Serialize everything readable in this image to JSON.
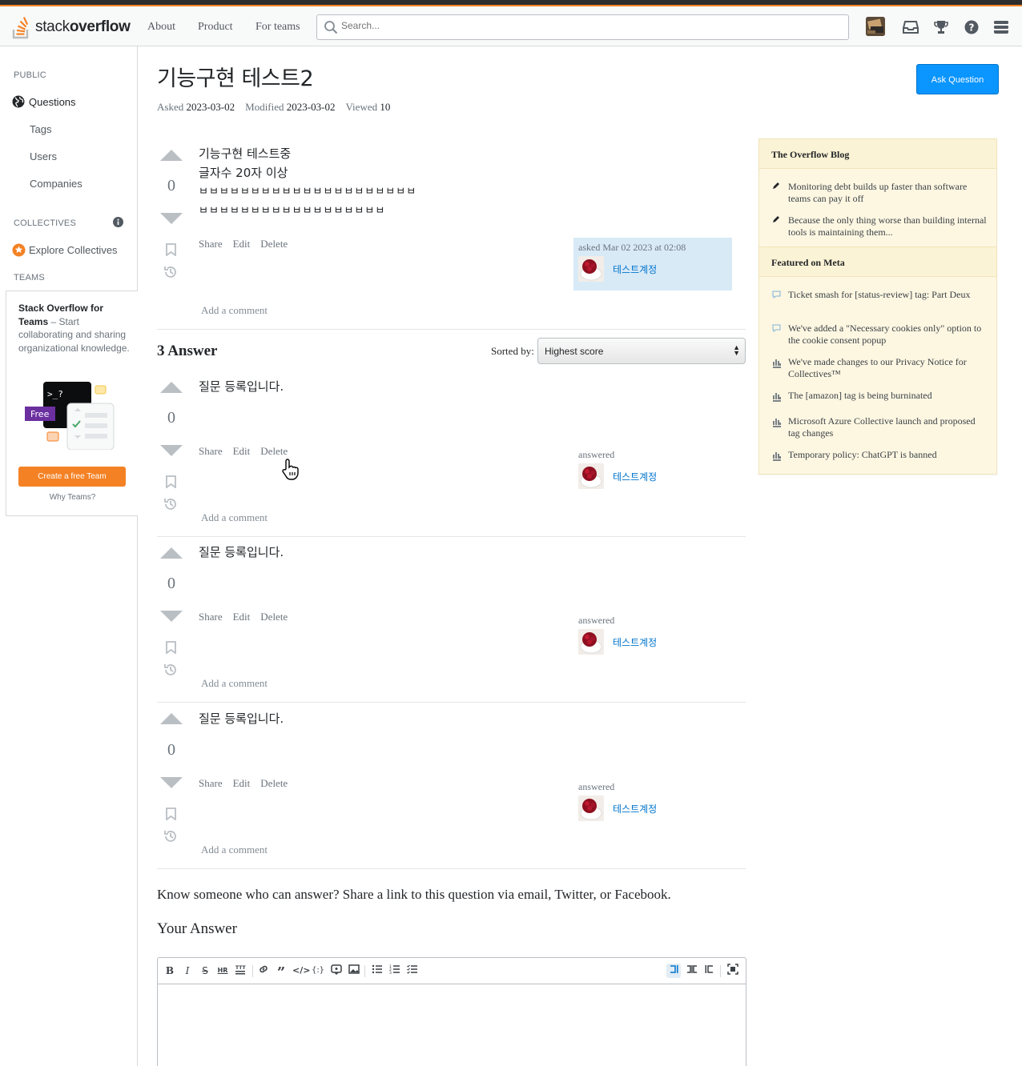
{
  "header": {
    "logo_light": "stack",
    "logo_bold": "overflow",
    "nav": [
      "About",
      "Product",
      "For teams"
    ],
    "search_placeholder": "Search..."
  },
  "sidebar": {
    "public_heading": "PUBLIC",
    "items": [
      "Questions",
      "Tags",
      "Users",
      "Companies"
    ],
    "collectives_heading": "COLLECTIVES",
    "explore_collectives": "Explore Collectives",
    "teams_heading": "TEAMS",
    "teams_promo_title": "Stack Overflow for Teams",
    "teams_promo_text": " – Start collaborating and sharing organizational knowledge.",
    "teams_illustration_prompt": ">_?",
    "teams_illustration_badge": "Free",
    "create_team_label": "Create a free Team",
    "why_teams_label": "Why Teams?"
  },
  "question": {
    "title": "기능구현 테스트2",
    "asked_label": "Asked",
    "asked_value": "2023-03-02",
    "modified_label": "Modified",
    "modified_value": "2023-03-02",
    "viewed_label": "Viewed",
    "viewed_value": "10",
    "ask_button": "Ask Question",
    "score": "0",
    "body_lines": [
      "기능구현 테스트중",
      "글자수 20자 이상",
      "ㅂㅂㅂㅂㅂㅂㅂㅂㅂㅂㅂㅂㅂㅂㅂㅂㅂㅂㅂㅂㅂ",
      "ㅂㅂㅂㅂㅂㅂㅂㅂㅂㅂㅂㅂㅂㅂㅂㅂㅂㅂ"
    ],
    "actions": [
      "Share",
      "Edit",
      "Delete"
    ],
    "signature_label": "asked Mar 02 2023 at 02:08",
    "user": "테스트계정",
    "add_comment": "Add a comment"
  },
  "answers_section": {
    "heading": "3 Answer",
    "sort_label": "Sorted by:",
    "sort_value": "Highest score"
  },
  "answers": [
    {
      "score": "0",
      "body": "질문 등록입니다.",
      "actions": [
        "Share",
        "Edit",
        "Delete"
      ],
      "signature_label": "answered",
      "user": "테스트계정",
      "add_comment": "Add a comment"
    },
    {
      "score": "0",
      "body": "질문 등록입니다.",
      "actions": [
        "Share",
        "Edit",
        "Delete"
      ],
      "signature_label": "answered",
      "user": "테스트계정",
      "add_comment": "Add a comment"
    },
    {
      "score": "0",
      "body": "질문 등록입니다.",
      "actions": [
        "Share",
        "Edit",
        "Delete"
      ],
      "signature_label": "answered",
      "user": "테스트계정",
      "add_comment": "Add a comment"
    }
  ],
  "footer": {
    "share_text": "Know someone who can answer? Share a link to this question via email, Twitter, or Facebook.",
    "your_answer": "Your Answer"
  },
  "editor_toolbar": [
    "bold-icon",
    "italic-icon",
    "strikethrough-icon",
    "heading-icon",
    "horizontal-rule-icon",
    "link-icon",
    "blockquote-icon",
    "code-icon",
    "code-block-icon",
    "snippet-icon",
    "image-icon",
    "bullet-list-icon",
    "numbered-list-icon",
    "task-list-icon",
    "preview-left-icon",
    "preview-split-icon",
    "preview-right-icon",
    "fullscreen-icon"
  ],
  "right_sidebar": {
    "blog_heading": "The Overflow Blog",
    "blog_items": [
      "Monitoring debt builds up faster than software teams can pay it off",
      "Because the only thing worse than building internal tools is maintaining them..."
    ],
    "meta_heading": "Featured on Meta",
    "meta_items": [
      "Ticket smash for [status-review] tag: Part Deux",
      "We've added a \"Necessary cookies only\" option to the cookie consent popup",
      "We've made changes to our Privacy Notice for Collectives™",
      "The [amazon] tag is being burninated",
      "Microsoft Azure Collective launch and proposed tag changes",
      "Temporary policy: ChatGPT is banned"
    ]
  },
  "colors": {
    "brand_orange": "#f48225",
    "primary_blue": "#0a95ff",
    "link_blue": "#0074cc",
    "owner_signature_bg": "#d9eaf7",
    "widget_bg": "#fdf7e2"
  }
}
